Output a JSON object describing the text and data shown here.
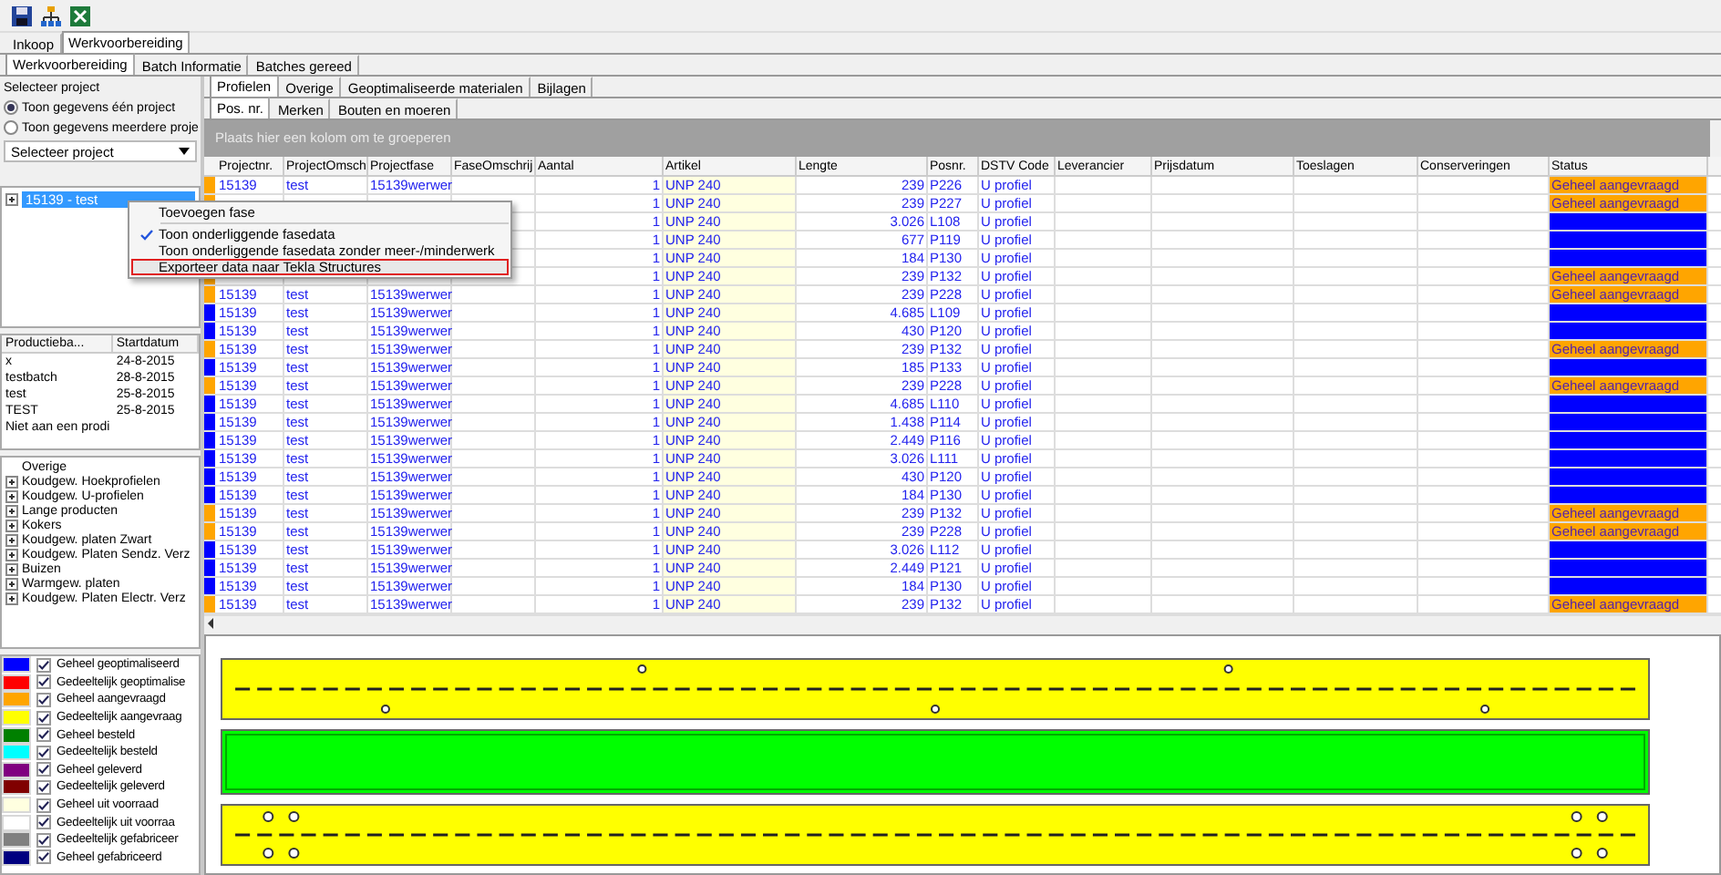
{
  "main_tabs": [
    {
      "label": "Inkoop",
      "selected": false
    },
    {
      "label": "Werkvoorbereiding",
      "selected": true
    }
  ],
  "sub_tabs": [
    {
      "label": "Werkvoorbereiding",
      "selected": true
    },
    {
      "label": "Batch Informatie",
      "selected": false
    },
    {
      "label": "Batches gereed",
      "selected": false
    }
  ],
  "project_select": {
    "title": "Selecteer project",
    "options": [
      {
        "label": "Toon gegevens één project",
        "selected": true
      },
      {
        "label": "Toon gegevens meerdere proje",
        "selected": false
      }
    ],
    "dropdown": "Selecteer project"
  },
  "project_tree": [
    {
      "label": "15139 - test",
      "selected": true,
      "expanded": false
    }
  ],
  "batches": {
    "columns": [
      "Productieba...",
      "Startdatum"
    ],
    "rows": [
      [
        "x",
        "24-8-2015"
      ],
      [
        "testbatch",
        "28-8-2015"
      ],
      [
        "test",
        "25-8-2015"
      ],
      [
        "TEST",
        "25-8-2015"
      ],
      [
        "Niet aan een prodi",
        null
      ]
    ]
  },
  "categories": [
    {
      "label": "Overige",
      "kind": "leaf"
    },
    {
      "label": "Koudgew. Hoekprofielen",
      "kind": "group"
    },
    {
      "label": "Koudgew. U-profielen",
      "kind": "group"
    },
    {
      "label": "Lange producten",
      "kind": "group"
    },
    {
      "label": "Kokers",
      "kind": "group"
    },
    {
      "label": "Koudgew. platen Zwart",
      "kind": "group"
    },
    {
      "label": "Koudgew. Platen Sendz. Verz",
      "kind": "group"
    },
    {
      "label": "Buizen",
      "kind": "group"
    },
    {
      "label": "Warmgew. platen",
      "kind": "group"
    },
    {
      "label": "Koudgew. Platen Electr. Verz",
      "kind": "group"
    }
  ],
  "legend": [
    {
      "color": "#0000ff",
      "checked": true,
      "label": "Geheel geoptimaliseerd"
    },
    {
      "color": "#ff0000",
      "checked": true,
      "label": "Gedeeltelijk geoptimalise"
    },
    {
      "color": "#ffa500",
      "checked": true,
      "label": "Geheel aangevraagd"
    },
    {
      "color": "#ffff00",
      "checked": true,
      "label": "Gedeeltelijk aangevraag"
    },
    {
      "color": "#008000",
      "checked": true,
      "label": "Geheel besteld"
    },
    {
      "color": "#00ffff",
      "checked": true,
      "label": "Gedeeltelijk besteld"
    },
    {
      "color": "#800080",
      "checked": true,
      "label": "Geheel geleverd"
    },
    {
      "color": "#800000",
      "checked": true,
      "label": "Gedeeltelijk geleverd"
    },
    {
      "color": "#ffffe0",
      "checked": true,
      "label": "Geheel uit voorraad"
    },
    {
      "color": "#ffffff",
      "checked": true,
      "label": "Gedeeltelijk uit voorraa"
    },
    {
      "color": "#808080",
      "checked": true,
      "label": "Gedeeltelijk gefabriceer"
    },
    {
      "color": "#000080",
      "checked": true,
      "label": "Geheel gefabriceerd"
    }
  ],
  "detail_tabs": [
    {
      "label": "Profielen",
      "selected": true
    },
    {
      "label": "Overige",
      "selected": false
    },
    {
      "label": "Geoptimaliseerde materialen",
      "selected": false
    },
    {
      "label": "Bijlagen",
      "selected": false
    }
  ],
  "detail_sub_tabs": [
    {
      "label": "Pos. nr.",
      "selected": true
    },
    {
      "label": "Merken",
      "selected": false
    },
    {
      "label": "Bouten en moeren",
      "selected": false
    }
  ],
  "group_hint": "Plaats hier een kolom om te groeperen",
  "table": {
    "columns": [
      {
        "label": "Projectnr.",
        "kind": "text"
      },
      {
        "label": "ProjectOmsch",
        "kind": "text"
      },
      {
        "label": "Projectfase",
        "kind": "text"
      },
      {
        "label": "FaseOmschrij",
        "kind": "text"
      },
      {
        "label": "Aantal",
        "kind": "number"
      },
      {
        "label": "Artikel",
        "kind": "article"
      },
      {
        "label": "Lengte",
        "kind": "number"
      },
      {
        "label": "Posnr.",
        "kind": "text"
      },
      {
        "label": "DSTV Code",
        "kind": "text"
      },
      {
        "label": "Leverancier",
        "kind": "text"
      },
      {
        "label": "Prijsdatum",
        "kind": "text"
      },
      {
        "label": "Toeslagen",
        "kind": "text"
      },
      {
        "label": "Conserveringen",
        "kind": "text"
      },
      {
        "label": "Status",
        "kind": "status"
      }
    ],
    "rows": [
      {
        "color": "#ffa500",
        "cells": [
          "15139",
          "test",
          "15139werwer",
          null,
          "1",
          "UNP 240",
          "239",
          "P226",
          "U profiel",
          null,
          null,
          null,
          null,
          "Geheel aangevraagd"
        ]
      },
      {
        "color": "#ffa500",
        "cells": [
          null,
          null,
          null,
          null,
          "1",
          "UNP 240",
          "239",
          "P227",
          "U profiel",
          null,
          null,
          null,
          null,
          "Geheel aangevraagd"
        ]
      },
      {
        "color": "#0000ff",
        "cells": [
          null,
          null,
          null,
          null,
          "1",
          "UNP 240",
          "3.026",
          "L108",
          "U profiel",
          null,
          null,
          null,
          null,
          null
        ]
      },
      {
        "color": "#0000ff",
        "cells": [
          null,
          null,
          null,
          null,
          "1",
          "UNP 240",
          "677",
          "P119",
          "U profiel",
          null,
          null,
          null,
          null,
          null
        ]
      },
      {
        "color": "#0000ff",
        "cells": [
          null,
          null,
          null,
          null,
          "1",
          "UNP 240",
          "184",
          "P130",
          "U profiel",
          null,
          null,
          null,
          null,
          null
        ]
      },
      {
        "color": "#ffa500",
        "cells": [
          null,
          null,
          null,
          null,
          "1",
          "UNP 240",
          "239",
          "P132",
          "U profiel",
          null,
          null,
          null,
          null,
          "Geheel aangevraagd"
        ]
      },
      {
        "color": "#ffa500",
        "cells": [
          "15139",
          "test",
          "15139werwer",
          null,
          "1",
          "UNP 240",
          "239",
          "P228",
          "U profiel",
          null,
          null,
          null,
          null,
          "Geheel aangevraagd"
        ]
      },
      {
        "color": "#0000ff",
        "cells": [
          "15139",
          "test",
          "15139werwer",
          null,
          "1",
          "UNP 240",
          "4.685",
          "L109",
          "U profiel",
          null,
          null,
          null,
          null,
          null
        ]
      },
      {
        "color": "#0000ff",
        "cells": [
          "15139",
          "test",
          "15139werwer",
          null,
          "1",
          "UNP 240",
          "430",
          "P120",
          "U profiel",
          null,
          null,
          null,
          null,
          null
        ]
      },
      {
        "color": "#ffa500",
        "cells": [
          "15139",
          "test",
          "15139werwer",
          null,
          "1",
          "UNP 240",
          "239",
          "P132",
          "U profiel",
          null,
          null,
          null,
          null,
          "Geheel aangevraagd"
        ]
      },
      {
        "color": "#0000ff",
        "cells": [
          "15139",
          "test",
          "15139werwer",
          null,
          "1",
          "UNP 240",
          "185",
          "P133",
          "U profiel",
          null,
          null,
          null,
          null,
          null
        ]
      },
      {
        "color": "#ffa500",
        "cells": [
          "15139",
          "test",
          "15139werwer",
          null,
          "1",
          "UNP 240",
          "239",
          "P228",
          "U profiel",
          null,
          null,
          null,
          null,
          "Geheel aangevraagd"
        ]
      },
      {
        "color": "#0000ff",
        "cells": [
          "15139",
          "test",
          "15139werwer",
          null,
          "1",
          "UNP 240",
          "4.685",
          "L110",
          "U profiel",
          null,
          null,
          null,
          null,
          null
        ]
      },
      {
        "color": "#0000ff",
        "cells": [
          "15139",
          "test",
          "15139werwer",
          null,
          "1",
          "UNP 240",
          "1.438",
          "P114",
          "U profiel",
          null,
          null,
          null,
          null,
          null
        ]
      },
      {
        "color": "#0000ff",
        "cells": [
          "15139",
          "test",
          "15139werwer",
          null,
          "1",
          "UNP 240",
          "2.449",
          "P116",
          "U profiel",
          null,
          null,
          null,
          null,
          null
        ]
      },
      {
        "color": "#0000ff",
        "cells": [
          "15139",
          "test",
          "15139werwer",
          null,
          "1",
          "UNP 240",
          "3.026",
          "L111",
          "U profiel",
          null,
          null,
          null,
          null,
          null
        ]
      },
      {
        "color": "#0000ff",
        "cells": [
          "15139",
          "test",
          "15139werwer",
          null,
          "1",
          "UNP 240",
          "430",
          "P120",
          "U profiel",
          null,
          null,
          null,
          null,
          null
        ]
      },
      {
        "color": "#0000ff",
        "cells": [
          "15139",
          "test",
          "15139werwer",
          null,
          "1",
          "UNP 240",
          "184",
          "P130",
          "U profiel",
          null,
          null,
          null,
          null,
          null
        ]
      },
      {
        "color": "#ffa500",
        "cells": [
          "15139",
          "test",
          "15139werwer",
          null,
          "1",
          "UNP 240",
          "239",
          "P132",
          "U profiel",
          null,
          null,
          null,
          null,
          "Geheel aangevraagd"
        ]
      },
      {
        "color": "#ffa500",
        "cells": [
          "15139",
          "test",
          "15139werwer",
          null,
          "1",
          "UNP 240",
          "239",
          "P228",
          "U profiel",
          null,
          null,
          null,
          null,
          "Geheel aangevraagd"
        ]
      },
      {
        "color": "#0000ff",
        "cells": [
          "15139",
          "test",
          "15139werwer",
          null,
          "1",
          "UNP 240",
          "3.026",
          "L112",
          "U profiel",
          null,
          null,
          null,
          null,
          null
        ]
      },
      {
        "color": "#0000ff",
        "cells": [
          "15139",
          "test",
          "15139werwer",
          null,
          "1",
          "UNP 240",
          "2.449",
          "P121",
          "U profiel",
          null,
          null,
          null,
          null,
          null
        ]
      },
      {
        "color": "#0000ff",
        "cells": [
          "15139",
          "test",
          "15139werwer",
          null,
          "1",
          "UNP 240",
          "184",
          "P130",
          "U profiel",
          null,
          null,
          null,
          null,
          null
        ]
      },
      {
        "color": "#ffa500",
        "cells": [
          "15139",
          "test",
          "15139werwer",
          null,
          "1",
          "UNP 240",
          "239",
          "P132",
          "U profiel",
          null,
          null,
          null,
          null,
          "Geheel aangevraagd"
        ]
      }
    ]
  },
  "strips": [
    {
      "color": "#ffff00"
    },
    {
      "color": "#00ff00"
    },
    {
      "color": "#ffff00"
    }
  ],
  "context_menu": [
    {
      "label": "Toevoegen fase",
      "checked": false,
      "selected": false
    },
    {
      "label": "Toon onderliggende fasedata",
      "checked": true,
      "selected": false
    },
    {
      "label": "Toon onderliggende fasedata zonder meer-/minderwerk",
      "checked": false,
      "selected": false
    },
    {
      "label": "Exporteer data naar Tekla Structures",
      "checked": false,
      "selected": true
    }
  ]
}
